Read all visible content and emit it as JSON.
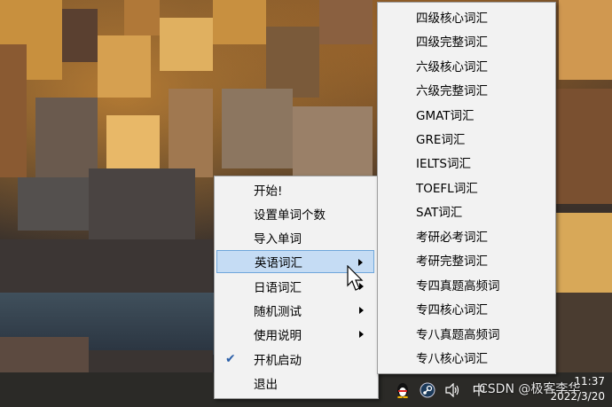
{
  "context_menu": {
    "items": [
      {
        "label": "开始!",
        "has_submenu": false,
        "checked": false,
        "highlighted": false
      },
      {
        "label": "设置单词个数",
        "has_submenu": false,
        "checked": false,
        "highlighted": false
      },
      {
        "label": "导入单词",
        "has_submenu": false,
        "checked": false,
        "highlighted": false
      },
      {
        "label": "英语词汇",
        "has_submenu": true,
        "checked": false,
        "highlighted": true
      },
      {
        "label": "日语词汇",
        "has_submenu": true,
        "checked": false,
        "highlighted": false
      },
      {
        "label": "随机测试",
        "has_submenu": true,
        "checked": false,
        "highlighted": false
      },
      {
        "label": "使用说明",
        "has_submenu": true,
        "checked": false,
        "highlighted": false
      },
      {
        "label": "开机启动",
        "has_submenu": false,
        "checked": true,
        "highlighted": false
      },
      {
        "label": "退出",
        "has_submenu": false,
        "checked": false,
        "highlighted": false
      }
    ]
  },
  "submenu": {
    "items": [
      "四级核心词汇",
      "四级完整词汇",
      "六级核心词汇",
      "六级完整词汇",
      "GMAT词汇",
      "GRE词汇",
      "IELTS词汇",
      "TOEFL词汇",
      "SAT词汇",
      "考研必考词汇",
      "考研完整词汇",
      "专四真题高频词",
      "专四核心词汇",
      "专八真题高频词",
      "专八核心词汇"
    ]
  },
  "taskbar": {
    "ime_label": "中",
    "watermark": "CSDN @极客李华",
    "clock_time": "11:37",
    "clock_date": "2022/3/20"
  },
  "icons": {
    "check": "check-icon",
    "submenu_arrow": "chevron-right-icon",
    "penguin": "qq-penguin-icon",
    "steam": "steam-icon",
    "volume": "volume-icon",
    "cursor": "mouse-cursor-icon"
  }
}
